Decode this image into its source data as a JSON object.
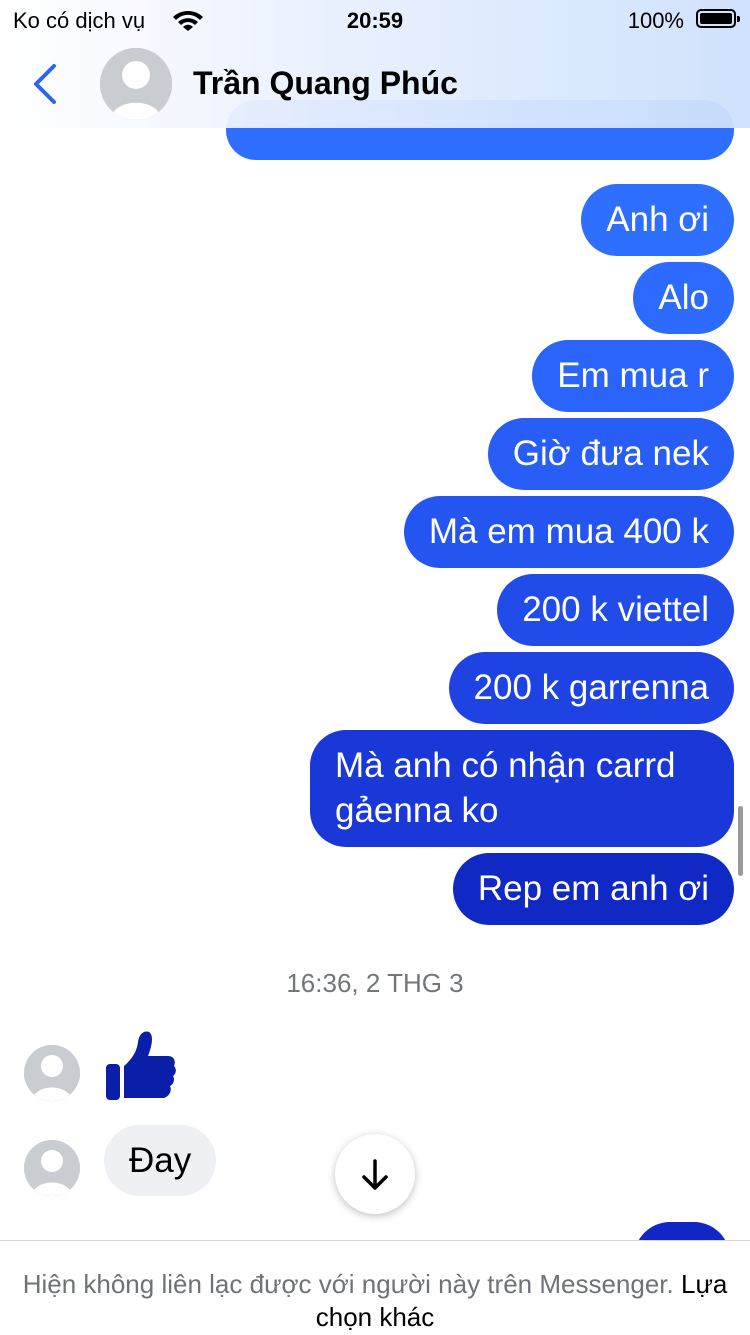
{
  "status_bar": {
    "carrier": "Ko có dịch vụ",
    "time": "20:59",
    "battery": "100%"
  },
  "header": {
    "contact_name": "Trần Quang Phúc",
    "back_icon": "chevron-left-icon"
  },
  "messages": {
    "outgoing": [
      "Anh ơi",
      "Alo",
      "Em mua r",
      "Giờ đưa nek",
      "Mà em mua 400 k",
      "200 k viettel",
      "200 k garrenna",
      "Mà anh có nhận carrd gảenna ko",
      "Rep em anh ơi"
    ],
    "timestamp": "16:36, 2 THG 3",
    "incoming": {
      "reaction_icon": "thumbs-up-icon",
      "text": "Đay"
    }
  },
  "footer": {
    "notice": "Hiện không liên lạc được với người này trên Messenger.",
    "link": "Lựa chọn khác"
  },
  "colors": {
    "bubble_top": "#2f6fff",
    "bubble_bottom": "#0f24c2",
    "accent": "#2e62f3"
  }
}
